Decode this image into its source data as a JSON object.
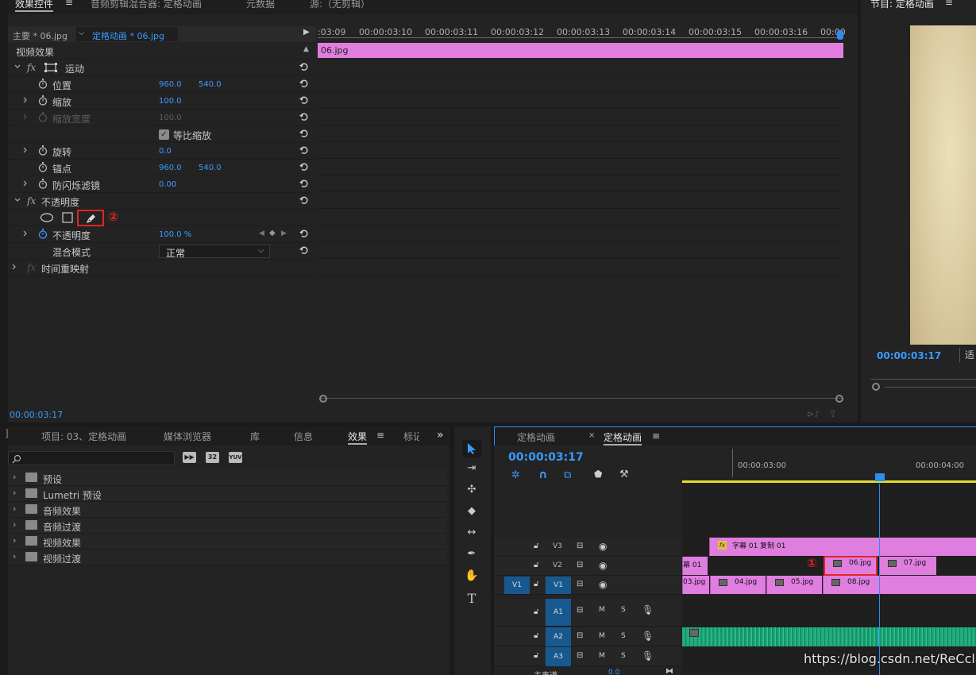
{
  "effect_controls": {
    "tabs": [
      "效果控件",
      "音频剪辑混合器: 定格动画",
      "元数据",
      "源:（无剪辑）"
    ],
    "master_label": "主要 * 06.jpg",
    "sequence_label": "定格动画 * 06.jpg",
    "section": "视频效果",
    "ruler": [
      ":03:09",
      "00:00:03:10",
      "00:00:03:11",
      "00:00:03:12",
      "00:00:03:13",
      "00:00:03:14",
      "00:00:03:15",
      "00:00:03:16",
      "00:00"
    ],
    "clip_name": "06.jpg",
    "motion": "运动",
    "position": {
      "label": "位置",
      "x": "960.0",
      "y": "540.0"
    },
    "scale": {
      "label": "缩放",
      "value": "100.0"
    },
    "scale_width": {
      "label": "缩放宽度",
      "value": "100.0"
    },
    "uniform_scale": "等比缩放",
    "rotation": {
      "label": "旋转",
      "value": "0.0"
    },
    "anchor": {
      "label": "锚点",
      "x": "960.0",
      "y": "540.0"
    },
    "antiflicker": {
      "label": "防闪烁滤镜",
      "value": "0.00"
    },
    "opacity_section": "不透明度",
    "opacity": {
      "label": "不透明度",
      "value": "100.0 %"
    },
    "blend": {
      "label": "混合模式",
      "value": "正常"
    },
    "time_remap": "时间重映射",
    "annotation_2": "②",
    "timecode": "00:00:03:17"
  },
  "program": {
    "title": "节目: 定格动画",
    "timecode": "00:00:03:17",
    "fit": "适"
  },
  "effects_panel": {
    "tabs": [
      "项目: 03、定格动画",
      "媒体浏览器",
      "库",
      "信息",
      "效果",
      "标记"
    ],
    "badges": [
      "32",
      "YUV"
    ],
    "items": [
      "预设",
      "Lumetri 预设",
      "音频效果",
      "音频过渡",
      "视频效果",
      "视频过渡"
    ]
  },
  "timeline": {
    "tabs": [
      "定格动画",
      "定格动画"
    ],
    "timecode": "00:00:03:17",
    "ruler": [
      "00:00:03:00",
      "00:00:04:00"
    ],
    "tracks": [
      "V3",
      "V2",
      "V1",
      "A1",
      "A2",
      "A3"
    ],
    "source_patch": [
      "V1"
    ],
    "ms": [
      "M",
      "S"
    ],
    "master": "主声道",
    "master_val": "0.0",
    "clips": {
      "v3": "字幕 01 复制 01",
      "v2": [
        "幕 01",
        "06.jpg",
        "07.jpg"
      ],
      "v1": [
        "03.jpg",
        "04.jpg",
        "05.jpg",
        "08.jpg"
      ]
    },
    "annotation_1": "①"
  },
  "watermark": "https://blog.csdn.net/ReCclay",
  "colors": {
    "accent": "#3b9bff",
    "clip_pink": "#e07ee0",
    "audio_green": "#1fa87a",
    "annotation_red": "#e02424"
  }
}
